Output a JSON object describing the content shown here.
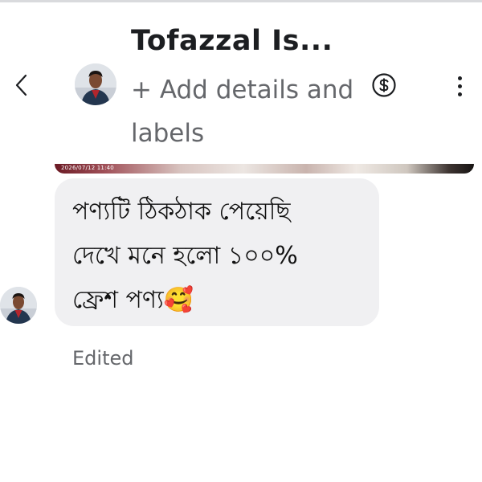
{
  "header": {
    "title": "Tofazzal Is...",
    "subtitle": "+ Add details and labels",
    "back_icon": "chevron-left-icon",
    "payment_icon": "dollar-circle-icon",
    "more_icon": "more-vertical-icon"
  },
  "media": {
    "timestamp": "2026/07/12 11:40"
  },
  "message": {
    "text": "পণ্যটি ঠিকঠাক পেয়েছি\nদেখে মনে হলো ১০০%\nফ্রেশ পণ্য🥰",
    "status": "Edited"
  },
  "colors": {
    "bubble": "#f0f0f2",
    "secondary_text": "#65676b",
    "primary_text": "#1c1e21"
  }
}
